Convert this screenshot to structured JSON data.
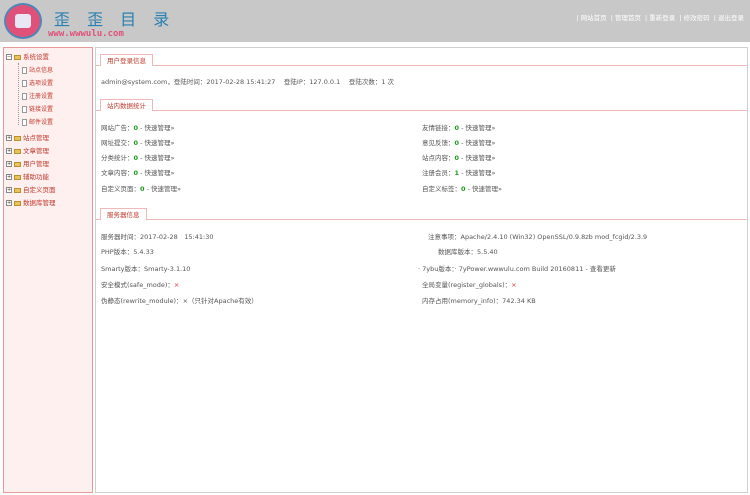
{
  "header": {
    "logo_title": "歪 歪 目 录",
    "logo_url": "www.wwwulu.com",
    "nav": [
      "| 网站首页",
      "| 管理首页",
      "| 重新登录",
      "| 修改密码",
      "| 退出登录"
    ]
  },
  "sidebar": {
    "groups": [
      {
        "label": "系统设置",
        "expanded": true,
        "items": [
          "站点信息",
          "选项设置",
          "注册设置",
          "链接设置",
          "邮件设置"
        ]
      },
      {
        "label": "站点管理",
        "expanded": false
      },
      {
        "label": "文章管理",
        "expanded": false
      },
      {
        "label": "用户管理",
        "expanded": false
      },
      {
        "label": "辅助功能",
        "expanded": false
      },
      {
        "label": "自定义页面",
        "expanded": false
      },
      {
        "label": "数据库管理",
        "expanded": false
      }
    ]
  },
  "login": {
    "section_title": "用户登录信息",
    "email": "admin@system.com",
    "text": "admin@system.com，登陆时间：2017-02-28 15:41:27 　登陆IP：127.0.0.1 　登陆次数：1 次"
  },
  "stats": {
    "section_title": "站内数据统计",
    "left": [
      {
        "label": "网站广告：",
        "value": "0",
        "link": "快速管理»"
      },
      {
        "label": "网址提交：",
        "value": "0",
        "link": "快速管理»"
      },
      {
        "label": "分类统计：",
        "value": "0",
        "link": "快速管理»"
      },
      {
        "label": "文章内容：",
        "value": "0",
        "link": "快速管理»"
      },
      {
        "label": "自定义页面：",
        "value": "0",
        "link": "快速管理»"
      }
    ],
    "right": [
      {
        "label": "友情链接：",
        "value": "0",
        "link": "快速管理»"
      },
      {
        "label": "意见反馈：",
        "value": "0",
        "link": "快速管理»"
      },
      {
        "label": "站点内容：",
        "value": "0",
        "link": "快速管理»"
      },
      {
        "label": "注册会员：",
        "value": "1",
        "link": "快速管理»"
      },
      {
        "label": "自定义标签：",
        "value": "0",
        "link": "快速管理»"
      }
    ],
    "separator": "-"
  },
  "server": {
    "section_title": "服务器信息",
    "left": [
      {
        "label": "服务器时间：",
        "value": "2017-02-28　15:41:30",
        "style": "plain"
      },
      {
        "label": "PHP版本：",
        "value": "5.4.33",
        "style": "plain"
      },
      {
        "label": "Smarty版本：",
        "value": "Smarty-3.1.10",
        "style": "plain"
      },
      {
        "label": "安全模式(safe_mode)：",
        "value": "×",
        "style": "red"
      },
      {
        "label": "伪静态(rewrite_module)：",
        "value": "×（只针对Apache有效）",
        "style": "plain"
      }
    ],
    "right": [
      {
        "label": "注意事项：",
        "value": "Apache/2.4.10 (Win32) OpenSSL/0.9.8zb mod_fcgid/2.3.9",
        "style": "plain"
      },
      {
        "label": "数据库版本：",
        "value": "5.5.40",
        "style": "plain"
      },
      {
        "label": "· 7ybu版本：",
        "value": "· 7yPower.wwwulu.com Build 20160811 - 查看更新",
        "style": "plain"
      },
      {
        "label": "全局变量(register_globals)：",
        "value": "×",
        "style": "red"
      },
      {
        "label": "内存占用(memory_info)：",
        "value": "742.34 KB",
        "style": "plain"
      }
    ]
  },
  "colors": {
    "accent_red": "#c0392b",
    "value_green": "#1a9a1a",
    "header_bg": "#c8c8c8",
    "sidebar_bg": "#fff0f0",
    "logo_pink": "#e0517a",
    "logo_blue": "#2a7fb3"
  }
}
